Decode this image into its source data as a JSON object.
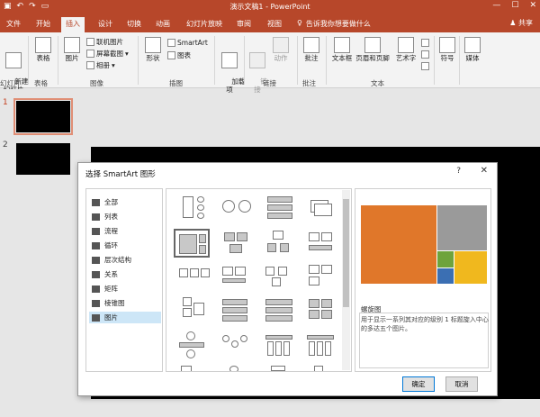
{
  "window": {
    "title": "演示文稿1 - PowerPoint",
    "min_glyph": "—",
    "max_glyph": "☐",
    "close_glyph": "✕"
  },
  "qat": {
    "save_glyph": "▣",
    "undo_glyph": "↶",
    "redo_glyph": "↷",
    "present_glyph": "▭"
  },
  "tabs": [
    {
      "label": "文件"
    },
    {
      "label": "开始"
    },
    {
      "label": "插入"
    },
    {
      "label": "设计"
    },
    {
      "label": "切换"
    },
    {
      "label": "动画"
    },
    {
      "label": "幻灯片放映"
    },
    {
      "label": "审阅"
    },
    {
      "label": "视图"
    }
  ],
  "tellme": "告诉我你想要做什么",
  "share": "共享",
  "ribbon": {
    "new_slide": "新建\n幻灯片",
    "table": "表格",
    "picture": "图片",
    "online_pictures": "联机图片",
    "screenshot": "屏幕截图",
    "album": "相册",
    "shapes": "形状",
    "smartart": "SmartArt",
    "chart": "图表",
    "addins": "加载\n项",
    "link": "链\n接",
    "action": "动作",
    "comment": "批注",
    "textbox": "文本框",
    "header_footer": "页眉和页脚",
    "wordart": "艺术字",
    "symbol": "符号",
    "media": "媒体",
    "groups": {
      "slides": "幻灯片",
      "tables": "表格",
      "images": "图像",
      "illustrations": "插图",
      "links": "链接",
      "comments": "批注",
      "text": "文本"
    }
  },
  "slides": [
    {
      "num": "1"
    },
    {
      "num": "2"
    }
  ],
  "dialog": {
    "title": "选择 SmartArt 图形",
    "help": "?",
    "close": "✕",
    "categories": [
      {
        "label": "全部"
      },
      {
        "label": "列表"
      },
      {
        "label": "流程"
      },
      {
        "label": "循环"
      },
      {
        "label": "层次结构"
      },
      {
        "label": "关系"
      },
      {
        "label": "矩阵"
      },
      {
        "label": "棱锥图"
      },
      {
        "label": "图片"
      }
    ],
    "selected_category": "图片",
    "preview_name": "螺旋图",
    "preview_desc": "用于显示一系列其对应的级别 1 标题旋入中心的多达五个图片。",
    "ok": "确定",
    "cancel": "取消"
  },
  "colors": {
    "accent": "#b7472a",
    "orange": "#e0772a",
    "gray": "#9a9a9a",
    "yellow": "#f0b81e",
    "green": "#6ea33c",
    "blue": "#3b6fb3"
  }
}
